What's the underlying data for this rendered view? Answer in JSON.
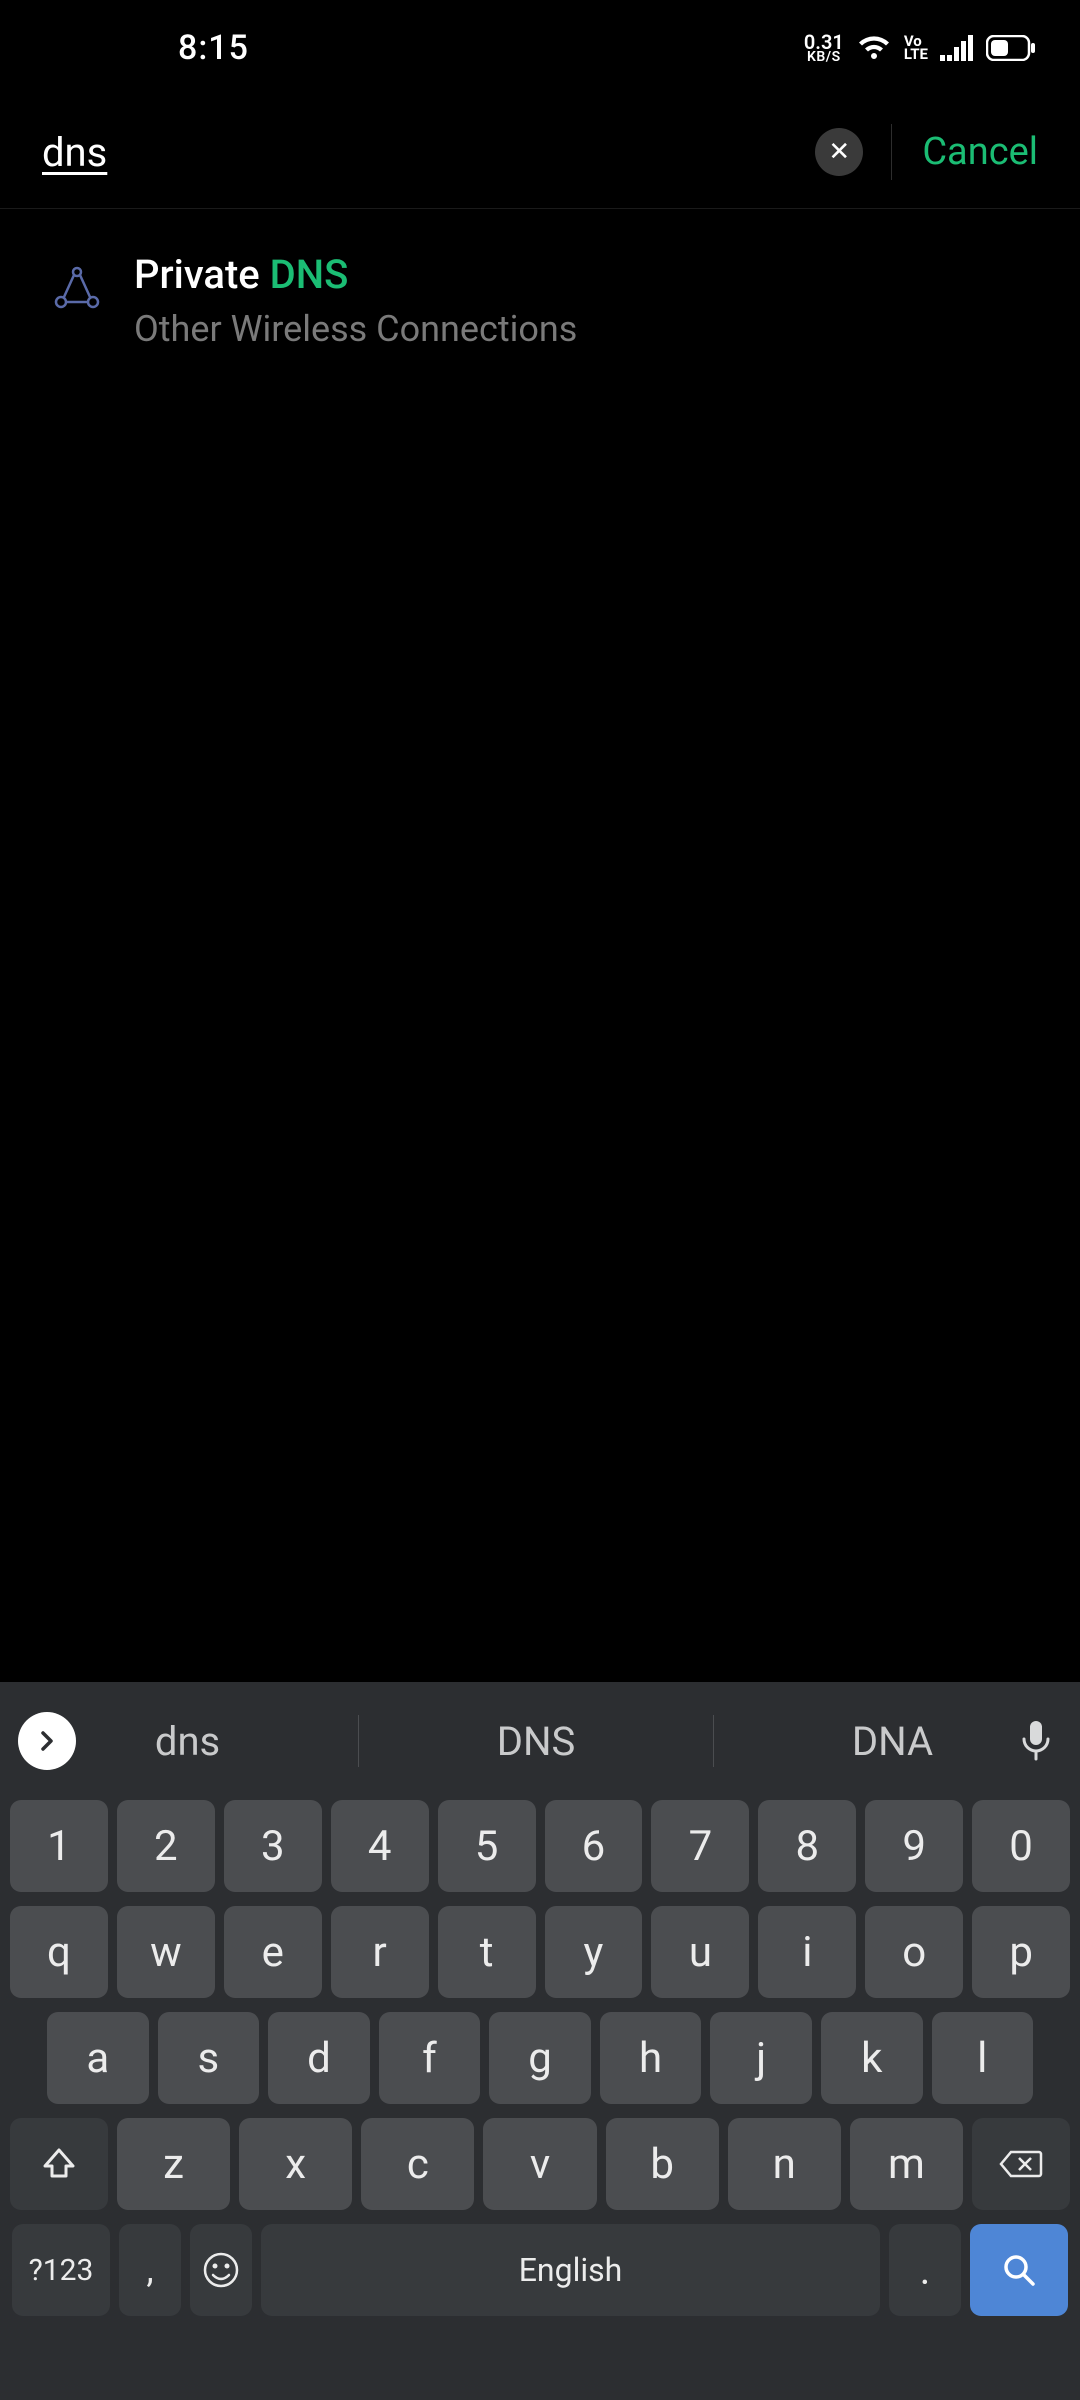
{
  "status": {
    "time": "8:15",
    "data_rate_num": "0.31",
    "data_rate_unit": "KB/S",
    "volte_top": "Vo",
    "volte_bot": "LTE"
  },
  "search": {
    "value": "dns",
    "cancel_label": "Cancel"
  },
  "results": [
    {
      "title_prefix": "Private ",
      "title_highlight": "DNS",
      "subtitle": "Other Wireless Connections"
    }
  ],
  "suggestions": [
    "dns",
    "DNS",
    "DNA"
  ],
  "keyboard": {
    "row1": [
      "1",
      "2",
      "3",
      "4",
      "5",
      "6",
      "7",
      "8",
      "9",
      "0"
    ],
    "row2": [
      "q",
      "w",
      "e",
      "r",
      "t",
      "y",
      "u",
      "i",
      "o",
      "p"
    ],
    "row3": [
      "a",
      "s",
      "d",
      "f",
      "g",
      "h",
      "j",
      "k",
      "l"
    ],
    "row4": [
      "z",
      "x",
      "c",
      "v",
      "b",
      "n",
      "m"
    ],
    "sym_label": "?123",
    "comma_label": ",",
    "space_label": "English",
    "period_label": "."
  }
}
